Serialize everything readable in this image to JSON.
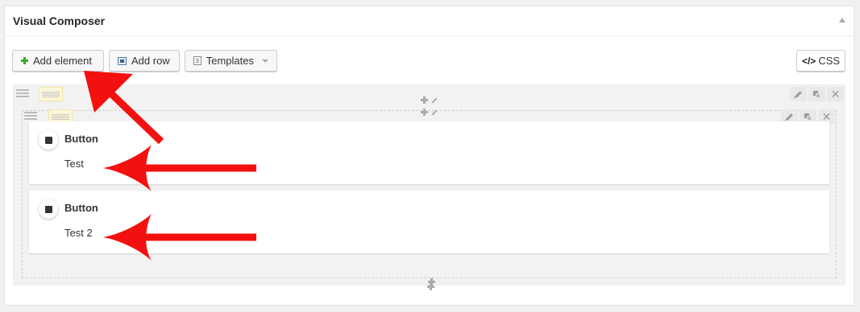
{
  "panel": {
    "title": "Visual Composer"
  },
  "toolbar": {
    "add_element": "Add element",
    "add_row": "Add row",
    "templates": "Templates",
    "css": "CSS"
  },
  "elements": [
    {
      "name": "Button",
      "text": "Test"
    },
    {
      "name": "Button",
      "text": "Test 2"
    }
  ],
  "colors": {
    "annotation_arrow": "#f2110e",
    "add_icon": "#3aa833"
  }
}
